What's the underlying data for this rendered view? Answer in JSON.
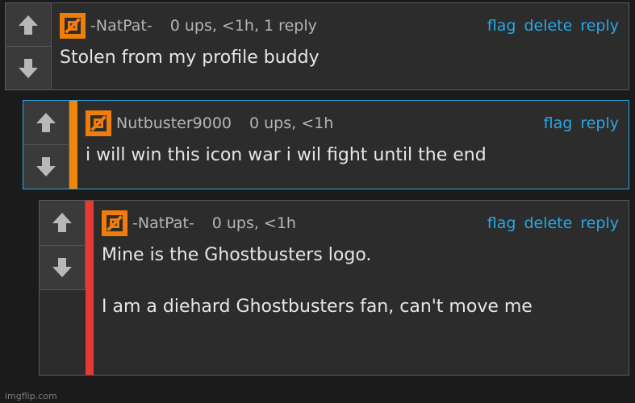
{
  "comments": [
    {
      "username": "-NatPat-",
      "meta": "0 ups, <1h, 1 reply",
      "actions": [
        "flag",
        "delete",
        "reply"
      ],
      "body": "Stolen from my profile buddy",
      "stripe_color": null
    },
    {
      "username": "Nutbuster9000",
      "meta": "0 ups, <1h",
      "actions": [
        "flag",
        "reply"
      ],
      "body": "i will win this icon war i wil fight until the end",
      "stripe_color": "#f0850a"
    },
    {
      "username": "-NatPat-",
      "meta": "0 ups, <1h",
      "actions": [
        "flag",
        "delete",
        "reply"
      ],
      "body": "Mine is the Ghostbusters logo.\n\nI am a diehard Ghostbusters fan, can't move me",
      "stripe_color": "#e53935"
    }
  ],
  "icons": {
    "upvote": "arrow-up-icon",
    "downvote": "arrow-down-icon",
    "avatar": "ghostbusters-avatar-icon"
  },
  "colors": {
    "link": "#2aa7e4",
    "avatar": "#f07c0a",
    "reply_border_orange": "#2aa7e4"
  },
  "watermark": "imgflip.com"
}
